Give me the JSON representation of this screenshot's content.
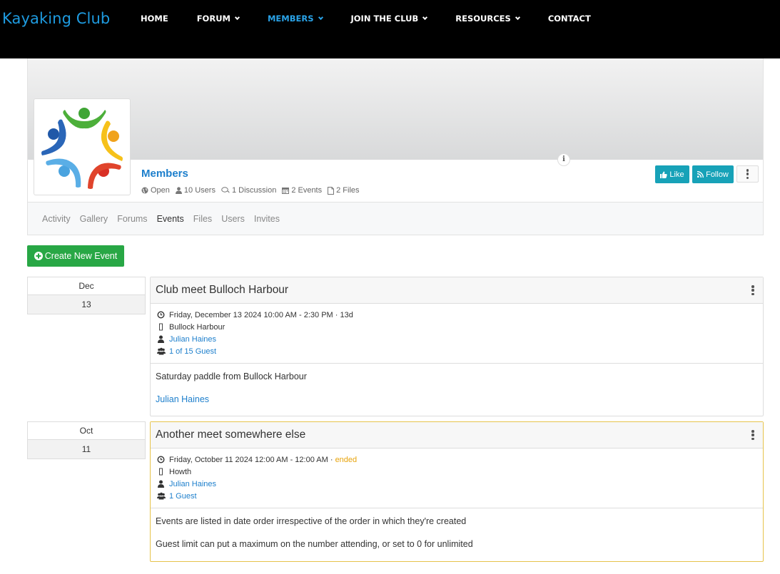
{
  "nav": {
    "brand": "Kayaking Club",
    "items": [
      {
        "label": "HOME",
        "dropdown": false,
        "active": false
      },
      {
        "label": "FORUM",
        "dropdown": true,
        "active": false
      },
      {
        "label": "MEMBERS",
        "dropdown": true,
        "active": true
      },
      {
        "label": "JOIN THE CLUB",
        "dropdown": true,
        "active": false
      },
      {
        "label": "RESOURCES",
        "dropdown": true,
        "active": false
      },
      {
        "label": "CONTACT",
        "dropdown": false,
        "active": false
      }
    ]
  },
  "group": {
    "title": "Members",
    "stats": {
      "privacy": "Open",
      "users": "10 Users",
      "discussions": "1 Discussion",
      "events": "2 Events",
      "files": "2 Files"
    },
    "like_label": "Like",
    "follow_label": "Follow",
    "info_glyph": "i"
  },
  "tabs": [
    {
      "label": "Activity",
      "active": false
    },
    {
      "label": "Gallery",
      "active": false
    },
    {
      "label": "Forums",
      "active": false
    },
    {
      "label": "Events",
      "active": true
    },
    {
      "label": "Files",
      "active": false
    },
    {
      "label": "Users",
      "active": false
    },
    {
      "label": "Invites",
      "active": false
    }
  ],
  "create_button": "Create New Event",
  "events": [
    {
      "month": "Dec",
      "day": "13",
      "title": "Club meet Bulloch Harbour",
      "datetime": "Friday, December 13 2024 10:00 AM - 2:30 PM · 13d",
      "status": "",
      "location": "Bullock Harbour",
      "organizer": "Julian Haines",
      "guests": "1 of 15 Guest",
      "description": [
        "Saturday paddle from Bullock Harbour"
      ],
      "footer_link": "Julian Haines"
    },
    {
      "month": "Oct",
      "day": "11",
      "title": "Another meet somewhere else",
      "datetime": "Friday, October 11 2024 12:00 AM - 12:00 AM ·",
      "status": "ended",
      "location": "Howth",
      "organizer": "Julian Haines",
      "guests": "1 Guest",
      "description": [
        "Events are listed in date order irrespective of the order in which they're created",
        "Guest limit can put a maximum on the number attending, or set to 0 for unlimited"
      ],
      "footer_link": ""
    }
  ],
  "colors": {
    "brand": "#1e9be0",
    "nav_active": "#2aa3e8",
    "link": "#1d7fcc",
    "info_button": "#17a2b8",
    "success_button": "#28a745",
    "ended": "#e8a40c"
  }
}
